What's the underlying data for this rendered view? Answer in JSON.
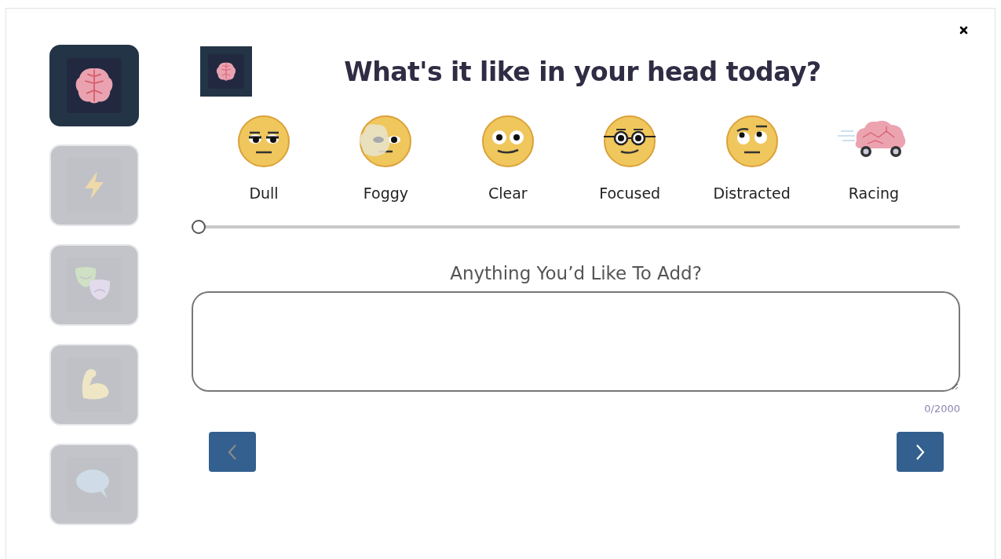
{
  "sidebar": {
    "items": [
      {
        "kind": "brain",
        "selected": true
      },
      {
        "kind": "bolt",
        "selected": false
      },
      {
        "kind": "masks",
        "selected": false
      },
      {
        "kind": "muscle",
        "selected": false
      },
      {
        "kind": "speech",
        "selected": false
      }
    ]
  },
  "header": {
    "title": "What's it like in your head today?"
  },
  "moods": [
    {
      "kind": "dull",
      "label": "Dull"
    },
    {
      "kind": "foggy",
      "label": "Foggy"
    },
    {
      "kind": "clear",
      "label": "Clear"
    },
    {
      "kind": "focused",
      "label": "Focused"
    },
    {
      "kind": "distracted",
      "label": "Distracted"
    },
    {
      "kind": "racing",
      "label": "Racing"
    }
  ],
  "slider": {
    "level": 0
  },
  "notes": {
    "label": "Anything You’d Like To Add?",
    "counter": "0/2000"
  },
  "nav": {
    "back": {
      "disabled": true
    },
    "next": {
      "disabled": false
    }
  }
}
